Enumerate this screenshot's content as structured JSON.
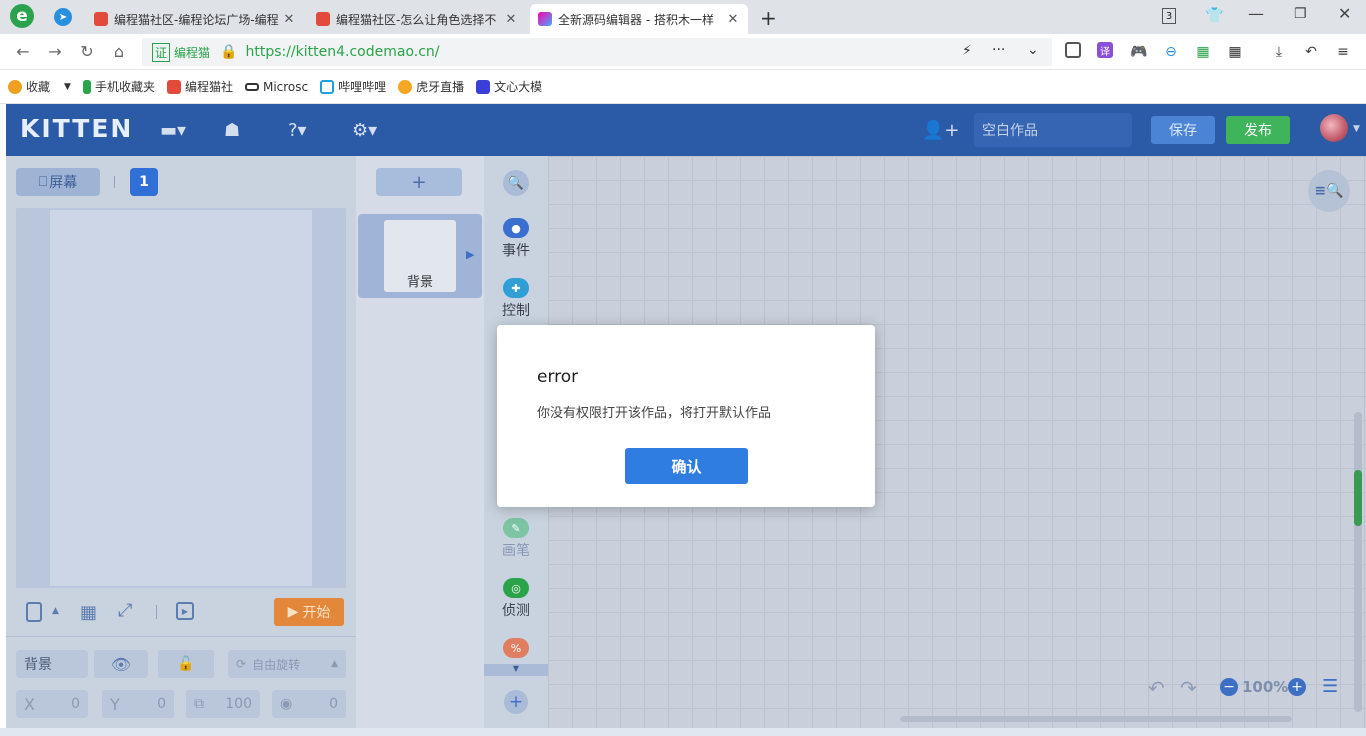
{
  "browser": {
    "tabs": [
      {
        "title": "编程猫社区-编程论坛广场-编程"
      },
      {
        "title": "编程猫社区-怎么让角色选择不"
      },
      {
        "title": "全新源码编辑器 - 搭积木一样"
      }
    ],
    "tab_count": "3",
    "cert_label": "编程猫",
    "url": "https://kitten4.codemao.cn/",
    "bookmarks": [
      "收藏",
      "手机收藏夹",
      "编程猫社",
      "Microsc",
      "哔哩哔哩",
      "虎牙直播",
      "文心大模"
    ]
  },
  "app": {
    "logo": "KITTEN",
    "title_placeholder": "空白作品",
    "save_label": "保存",
    "publish_label": "发布",
    "screen_label": "屏幕",
    "screen_number": "1",
    "add_scene": "+",
    "scene_name": "背景",
    "start_label": "开始",
    "sprite_name": "背景",
    "rotate_label": "自由旋转",
    "x_label": "X",
    "x_value": "0",
    "y_label": "Y",
    "y_value": "0",
    "size_value": "100",
    "dir_value": "0",
    "zoom": "100%",
    "categories": [
      {
        "label": "事件",
        "color": "#3a6fcf"
      },
      {
        "label": "控制",
        "color": "#2f9fd6"
      },
      {
        "label": "画笔",
        "color": "#7cc4a4"
      },
      {
        "label": "侦测",
        "color": "#2aa34a"
      }
    ]
  },
  "modal": {
    "title": "error",
    "message": "你没有权限打开该作品，将打开默认作品",
    "confirm_label": "确认"
  }
}
